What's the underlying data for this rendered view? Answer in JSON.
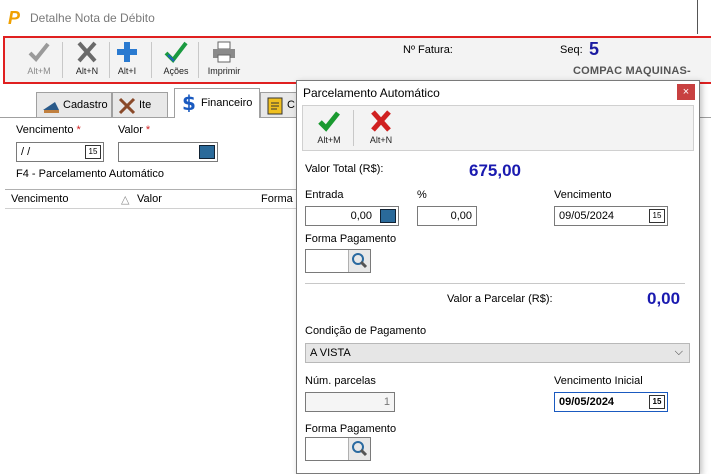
{
  "window": {
    "logo": "P",
    "title": "Detalhe Nota de Débito"
  },
  "toolbar": {
    "buttons": [
      {
        "icon": "check-icon",
        "label": "Alt+M"
      },
      {
        "icon": "x-icon",
        "label": "Alt+N"
      },
      {
        "icon": "plus-icon",
        "label": "Alt+I"
      },
      {
        "icon": "actions-icon",
        "label": "Ações"
      },
      {
        "icon": "printer-icon",
        "label": "Imprimir"
      }
    ],
    "fatura_label": "Nº Fatura:",
    "seq_label": "Seq:",
    "seq_value": "5",
    "company": "COMPAC MAQUINAS-"
  },
  "tabs": [
    {
      "label": "Cadastro",
      "icon": "cadastro-icon"
    },
    {
      "label": "Ite",
      "icon": "tools-icon"
    },
    {
      "label": "Financeiro",
      "icon": "dollar-icon"
    },
    {
      "label": "C",
      "icon": "notes-icon"
    }
  ],
  "financeiro": {
    "vencimento_label": "Vencimento",
    "vencimento_value": " / /",
    "valor_label": "Valor",
    "hint": "F4 - Parcelamento Automático",
    "grid_columns": [
      "Vencimento",
      "Valor",
      "Forma"
    ]
  },
  "dialog": {
    "title": "Parcelamento Automático",
    "close": "×",
    "buttons": [
      {
        "icon": "check-icon",
        "label": "Alt+M"
      },
      {
        "icon": "x-icon",
        "label": "Alt+N"
      }
    ],
    "valor_total_label": "Valor Total (R$):",
    "valor_total": "675,00",
    "entrada_label": "Entrada",
    "entrada_value": "0,00",
    "percent_label": "%",
    "percent_value": "0,00",
    "vencimento_label": "Vencimento",
    "vencimento_value": "09/05/2024",
    "forma_pagamento_label": "Forma Pagamento",
    "valor_parcelar_label": "Valor a Parcelar (R$):",
    "valor_parcelar": "0,00",
    "condicao_label": "Condição de Pagamento",
    "condicao_value": "A VISTA",
    "num_parcelas_label": "Núm. parcelas",
    "num_parcelas_value": "1",
    "vencimento_inicial_label": "Vencimento Inicial",
    "vencimento_inicial_value": "09/05/2024",
    "forma_pagamento2_label": "Forma Pagamento"
  }
}
